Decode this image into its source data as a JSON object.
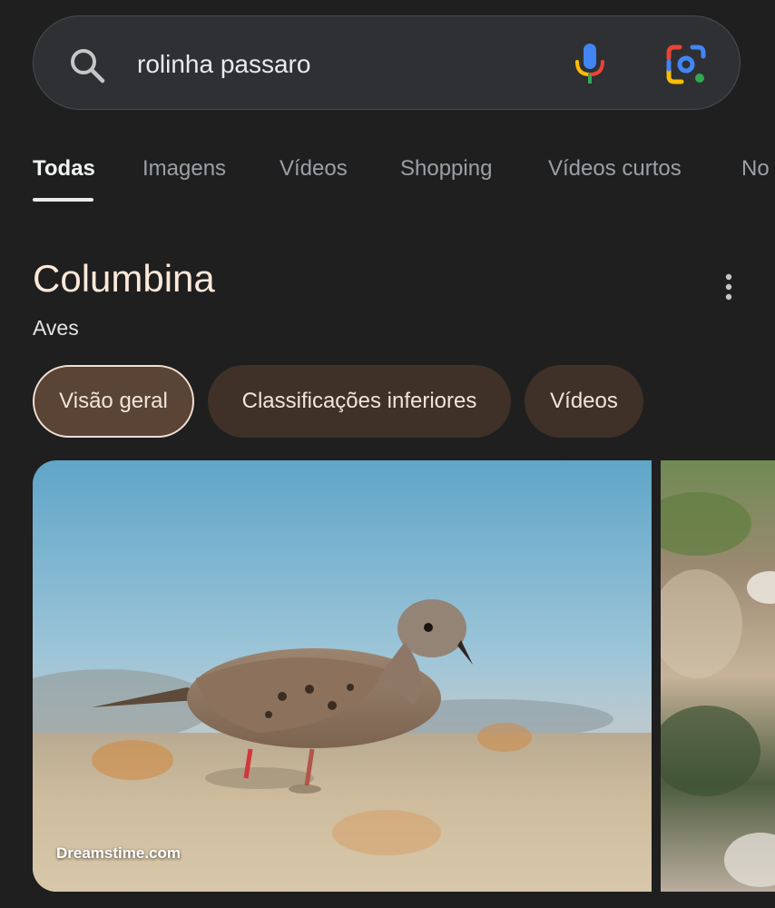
{
  "search": {
    "query": "rolinha passaro",
    "icons": [
      "search-icon",
      "mic-icon",
      "google-lens-icon"
    ]
  },
  "tabs": [
    {
      "label": "Todas",
      "active": true
    },
    {
      "label": "Imagens",
      "active": false
    },
    {
      "label": "Vídeos",
      "active": false
    },
    {
      "label": "Shopping",
      "active": false
    },
    {
      "label": "Vídeos curtos",
      "active": false
    },
    {
      "label": "No",
      "active": false
    }
  ],
  "entity": {
    "title": "Columbina",
    "subtitle": "Aves",
    "more_icon": "more-vert-icon"
  },
  "chips": [
    {
      "label": "Visão geral",
      "selected": true
    },
    {
      "label": "Classificações inferiores",
      "selected": false
    },
    {
      "label": "Vídeos",
      "selected": false
    }
  ],
  "images": {
    "main_source": "Dreamstime.com"
  },
  "colors": {
    "background": "#1f1f1f",
    "search_bar": "#2f3033",
    "chip": "#3f3127",
    "chip_selected": "#5a4436",
    "title": "#fde9d9"
  }
}
